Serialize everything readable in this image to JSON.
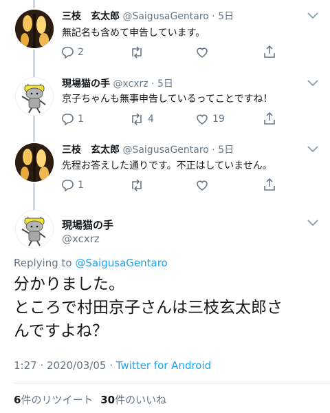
{
  "tweets": [
    {
      "name": "三枝　玄太郎",
      "handle": "@SaigusaGentaro",
      "time": "5日",
      "text": "無記名も含めて申告しています。",
      "replies": "2",
      "retweets": "",
      "likes": ""
    },
    {
      "name": "現場猫の手",
      "handle": "@xcxrz",
      "time": "5日",
      "text": "京子ちゃんも無事申告しているってことですね！",
      "replies": "1",
      "retweets": "4",
      "likes": "19"
    },
    {
      "name": "三枝　玄太郎",
      "handle": "@SaigusaGentaro",
      "time": "5日",
      "text": "先程お答えした通りです。不正はしていません。",
      "replies": "1",
      "retweets": "",
      "likes": ""
    }
  ],
  "focus": {
    "name": "現場猫の手",
    "handle": "@xcxrz",
    "replying_prefix": "Replying to ",
    "replying_to": "@SaigusaGentaro",
    "text_lines": [
      "分かりました。",
      "ところで村田京子さんは三枝玄太郎さ",
      "んですよね？"
    ],
    "time": "1:27 · 2020/03/05 · ",
    "source": "Twitter for Android",
    "retweet_count": "6",
    "retweet_label": "件のリツイート",
    "like_count": "30",
    "like_label": "件のいいね"
  },
  "separator": " · ",
  "colors": {
    "accent": "#1da1f2",
    "muted": "#657786",
    "text": "#14171a",
    "thread": "#cfd9de"
  },
  "icons": [
    "reply-icon",
    "retweet-icon",
    "like-icon",
    "share-icon",
    "chevron-down-icon"
  ]
}
